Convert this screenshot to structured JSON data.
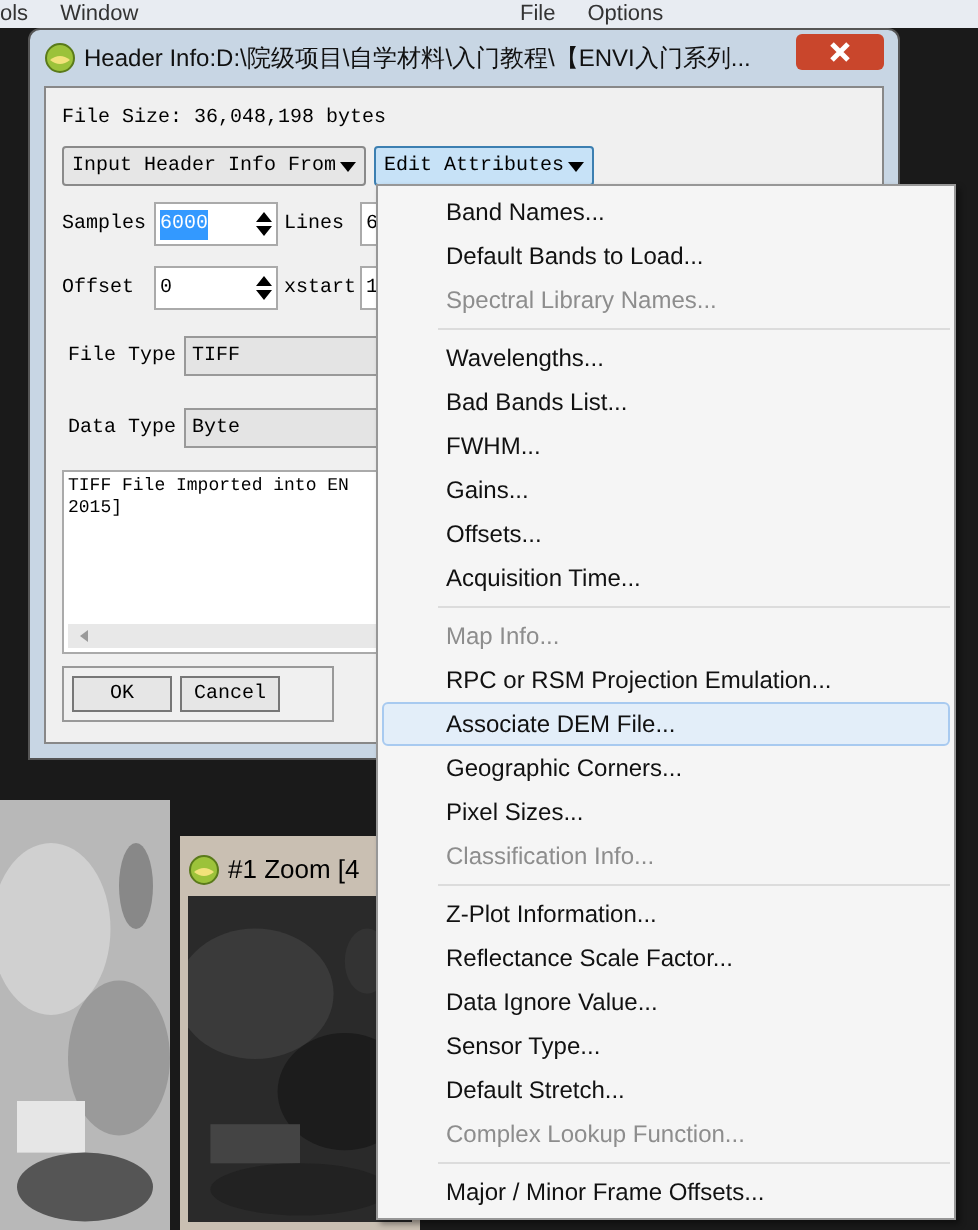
{
  "background_app": {
    "menu_left": [
      "ols",
      "Window"
    ],
    "menu_right": [
      "File",
      "Options"
    ]
  },
  "dialog": {
    "title": "Header Info:D:\\院级项目\\自学材料\\入门教程\\【ENVI入门系列...",
    "file_size": "File Size: 36,048,198 bytes",
    "menu_buttons": [
      {
        "label": "Input Header Info From",
        "selected": false
      },
      {
        "label": "Edit Attributes",
        "selected": true
      }
    ],
    "fields": [
      {
        "label": "Samples",
        "value": "6000",
        "selected": true,
        "label2": "Lines",
        "value2": "6"
      },
      {
        "label": "Offset",
        "value": "0",
        "selected": false,
        "label2": "xstart",
        "value2": "1"
      }
    ],
    "dropdowns": [
      {
        "label": "File Type",
        "value": "TIFF"
      },
      {
        "label": "Data Type",
        "value": "Byte"
      }
    ],
    "description": [
      "TIFF File Imported into EN",
      "2015]"
    ],
    "buttons": [
      "OK",
      "Cancel"
    ]
  },
  "zoom_window": {
    "title": "#1 Zoom [4"
  },
  "menu": [
    [
      {
        "label": "Band Names...",
        "disabled": false,
        "selected": false
      },
      {
        "label": "Default Bands to Load...",
        "disabled": false,
        "selected": false
      },
      {
        "label": "Spectral Library Names...",
        "disabled": true,
        "selected": false
      }
    ],
    [
      {
        "label": "Wavelengths...",
        "disabled": false,
        "selected": false
      },
      {
        "label": "Bad Bands List...",
        "disabled": false,
        "selected": false
      },
      {
        "label": "FWHM...",
        "disabled": false,
        "selected": false
      },
      {
        "label": "Gains...",
        "disabled": false,
        "selected": false
      },
      {
        "label": "Offsets...",
        "disabled": false,
        "selected": false
      },
      {
        "label": "Acquisition Time...",
        "disabled": false,
        "selected": false
      }
    ],
    [
      {
        "label": "Map Info...",
        "disabled": true,
        "selected": false
      },
      {
        "label": "RPC or RSM Projection Emulation...",
        "disabled": false,
        "selected": false
      },
      {
        "label": "Associate DEM File...",
        "disabled": false,
        "selected": true
      },
      {
        "label": "Geographic Corners...",
        "disabled": false,
        "selected": false
      },
      {
        "label": "Pixel Sizes...",
        "disabled": false,
        "selected": false
      },
      {
        "label": "Classification Info...",
        "disabled": true,
        "selected": false
      }
    ],
    [
      {
        "label": "Z-Plot Information...",
        "disabled": false,
        "selected": false
      },
      {
        "label": "Reflectance Scale Factor...",
        "disabled": false,
        "selected": false
      },
      {
        "label": "Data Ignore Value...",
        "disabled": false,
        "selected": false
      },
      {
        "label": "Sensor Type...",
        "disabled": false,
        "selected": false
      },
      {
        "label": "Default Stretch...",
        "disabled": false,
        "selected": false
      },
      {
        "label": "Complex Lookup Function...",
        "disabled": true,
        "selected": false
      }
    ],
    [
      {
        "label": "Major / Minor Frame Offsets...",
        "disabled": false,
        "selected": false
      }
    ]
  ]
}
